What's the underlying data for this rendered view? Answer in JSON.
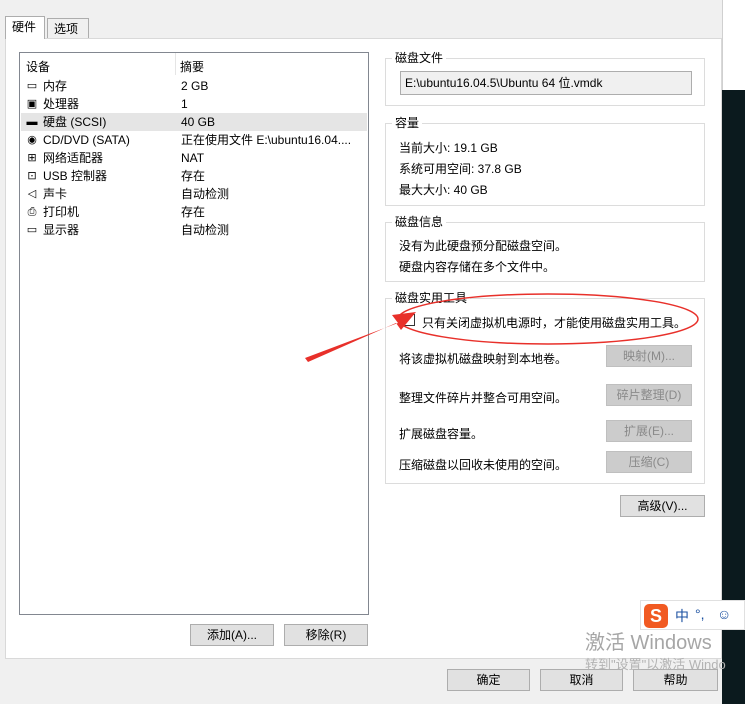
{
  "tabs": [
    "硬件",
    "选项"
  ],
  "devices": {
    "col_device": "设备",
    "col_summary": "摘要",
    "items": [
      {
        "name": "内存",
        "summary": "2 GB",
        "icon": "memory-icon",
        "glyph": "▭"
      },
      {
        "name": "处理器",
        "summary": "1",
        "icon": "cpu-icon",
        "glyph": "▣"
      },
      {
        "name": "硬盘 (SCSI)",
        "summary": "40 GB",
        "icon": "hard-disk-icon",
        "glyph": "▬"
      },
      {
        "name": "CD/DVD (SATA)",
        "summary": "正在使用文件 E:\\ubuntu16.04....",
        "icon": "cd-dvd-icon",
        "glyph": "◉"
      },
      {
        "name": "网络适配器",
        "summary": "NAT",
        "icon": "network-icon",
        "glyph": "⊞"
      },
      {
        "name": "USB 控制器",
        "summary": "存在",
        "icon": "usb-icon",
        "glyph": "⊡"
      },
      {
        "name": "声卡",
        "summary": "自动检测",
        "icon": "speaker-icon",
        "glyph": "◁"
      },
      {
        "name": "打印机",
        "summary": "存在",
        "icon": "printer-icon",
        "glyph": "⎙"
      },
      {
        "name": "显示器",
        "summary": "自动检测",
        "icon": "monitor-icon",
        "glyph": "▭"
      }
    ],
    "selected_index": 2
  },
  "buttons": {
    "add": "添加(A)...",
    "remove": "移除(R)",
    "ok": "确定",
    "cancel": "取消",
    "help": "帮助",
    "advanced": "高级(V)..."
  },
  "disk_file": {
    "legend": "磁盘文件",
    "path": "E:\\ubuntu16.04.5\\Ubuntu 64 位.vmdk"
  },
  "capacity": {
    "legend": "容量",
    "current": "当前大小: 19.1 GB",
    "available": "系统可用空间: 37.8 GB",
    "max": "最大大小: 40 GB"
  },
  "disk_info": {
    "legend": "磁盘信息",
    "line1": "没有为此硬盘预分配磁盘空间。",
    "line2": "硬盘内容存储在多个文件中。"
  },
  "utilities": {
    "legend": "磁盘实用工具",
    "notice": "只有关闭虚拟机电源时，才能使用磁盘实用工具。",
    "map_label": "将该虚拟机磁盘映射到本地卷。",
    "map_button": "映射(M)...",
    "defrag_label": "整理文件碎片并整合可用空间。",
    "defrag_button": "碎片整理(D)",
    "expand_label": "扩展磁盘容量。",
    "expand_button": "扩展(E)...",
    "compact_label": "压缩磁盘以回收未使用的空间。",
    "compact_button": "压缩(C)"
  },
  "watermark": {
    "line1": "激活 Windows",
    "line2": "转到\"设置\"以激活 Windo"
  },
  "ime": {
    "logo": "S",
    "lang": "中",
    "punct": "°,",
    "emoji": "☺"
  },
  "colors": {
    "annotation": "#e8302a",
    "selection": "#e5e5e5"
  }
}
